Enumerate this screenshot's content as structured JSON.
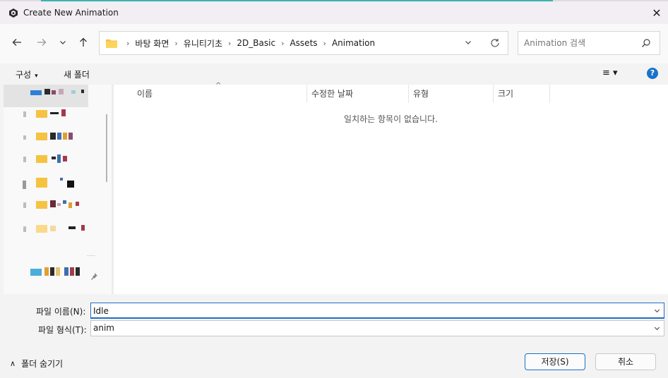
{
  "window": {
    "title": "Create New Animation",
    "close_glyph": "✕"
  },
  "nav": {
    "back_glyph": "←",
    "forward_glyph": "→",
    "recent_glyph": "⌄",
    "up_glyph": "↑",
    "breadcrumbs": [
      "바탕 화면",
      "유니티기초",
      "2D_Basic",
      "Assets",
      "Animation"
    ],
    "breadcrumb_sep": "›"
  },
  "search": {
    "placeholder": "Animation 검색"
  },
  "toolbar": {
    "organize_label": "구성",
    "organize_caret": "▾",
    "new_folder_label": "새 폴더",
    "view_glyph": "≡ ▾",
    "help_glyph": "?"
  },
  "columns": {
    "name": "이름",
    "modified": "수정한 날짜",
    "type": "유형",
    "size": "크기",
    "sort_glyph": "^"
  },
  "file_list": {
    "empty_text": "일치하는 항목이 없습니다."
  },
  "form": {
    "filename_label": "파일 이름(N):",
    "filename_value": "Idle",
    "filetype_label": "파일 형식(T):",
    "filetype_value": "anim"
  },
  "footer": {
    "hide_folders_label": "폴더 숨기기",
    "hide_folders_glyph": "∧",
    "save_label": "저장(S)",
    "cancel_label": "취소"
  },
  "colors": {
    "accent": "#1f6ec4",
    "teal_line": "#3bb3b0",
    "folder_yellow": "#f5c342"
  }
}
